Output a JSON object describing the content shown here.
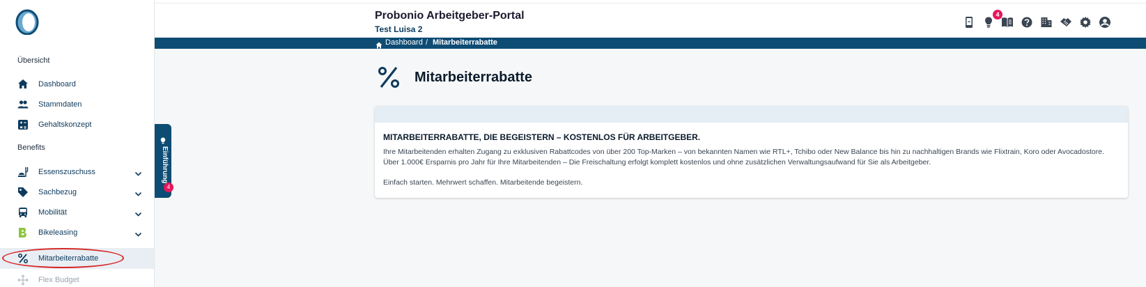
{
  "header": {
    "title": "Probonio Arbeitgeber-Portal",
    "subtitle": "Test Luisa 2",
    "notification_count": "4"
  },
  "breadcrumb": {
    "items": [
      "Dashboard",
      "/",
      "Mitarbeiterrabatte"
    ]
  },
  "sidebar": {
    "section_overview": "Übersicht",
    "section_benefits": "Benefits",
    "items": [
      {
        "label": "Dashboard",
        "icon": "home-icon"
      },
      {
        "label": "Stammdaten",
        "icon": "people-icon"
      },
      {
        "label": "Gehaltskonzept",
        "icon": "calculator-icon"
      },
      {
        "label": "Essenszuschuss",
        "icon": "food-icon"
      },
      {
        "label": "Sachbezug",
        "icon": "tag-icon"
      },
      {
        "label": "Mobilität",
        "icon": "bus-icon"
      },
      {
        "label": "Bikeleasing",
        "icon": "bikeleasing-logo-icon"
      },
      {
        "label": "Mitarbeiterrabatte",
        "icon": "percent-icon"
      },
      {
        "label": "Flex Budget",
        "icon": "flex-icon"
      }
    ]
  },
  "tab": {
    "label": "Einführung",
    "badge": "4"
  },
  "page": {
    "title": "Mitarbeiterrabatte"
  },
  "card": {
    "title": "MITARBEITERRABATTE, DIE BEGEISTERN – KOSTENLOS FÜR ARBEITGEBER.",
    "line1": "Ihre Mitarbeitenden erhalten Zugang zu exklusiven Rabattcodes von über 200 Top-Marken – von bekannten Namen wie RTL+, Tchibo oder New Balance bis hin zu nachhaltigen Brands wie Flixtrain, Koro oder Avocadostore.",
    "line2": "Über 1.000€ Ersparnis pro Jahr für Ihre Mitarbeitenden – Die Freischaltung erfolgt komplett kostenlos und ohne zusätzlichen Verwaltungsaufwand für Sie als Arbeitgeber.",
    "line3": "Einfach starten. Mehrwert schaffen. Mitarbeitende begeistern."
  },
  "colors": {
    "primary": "#0e4c74",
    "accent": "#e6175c",
    "highlight": "#d62828",
    "bikeleasing": "#8cc63f"
  }
}
